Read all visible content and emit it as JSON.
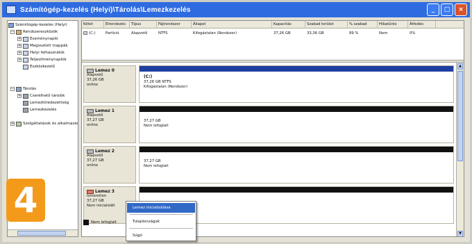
{
  "window": {
    "title": "Számítógép-kezelés (Helyi)\\Tárolás\\Lemezkezelés"
  },
  "tree": {
    "items": [
      {
        "label": "Számítógép-kezelés (Helyi)",
        "icon": "computer-icon"
      },
      {
        "label": "Rendszereszközök",
        "icon": "tools-icon"
      },
      {
        "label": "Eseménynapló",
        "icon": "event-viewer-icon"
      },
      {
        "label": "Megosztott mappák",
        "icon": "shared-folders-icon"
      },
      {
        "label": "Helyi felhasználók",
        "icon": "users-icon"
      },
      {
        "label": "Teljesítménynaplók",
        "icon": "performance-icon"
      },
      {
        "label": "Eszközkezelő",
        "icon": "device-manager-icon"
      },
      {
        "label": "Tárolás",
        "icon": "storage-icon"
      },
      {
        "label": "Cserélhető tárolók",
        "icon": "removable-storage-icon"
      },
      {
        "label": "Lemeztöredezettség",
        "icon": "defrag-icon"
      },
      {
        "label": "Lemezkezelés",
        "icon": "disk-management-icon"
      },
      {
        "label": "Szolgáltatások és alkalmazások",
        "icon": "services-icon"
      }
    ]
  },
  "volume_table": {
    "columns": [
      "Kötet",
      "Elrendezés",
      "Típus",
      "Fájlrendszer",
      "Állapot",
      "Kapacitás",
      "Szabad terület",
      "% szabad",
      "Hibatűrés",
      "Átfedés"
    ],
    "rows": [
      [
        "(C:)",
        "Partíció",
        "Alapvető",
        "NTFS",
        "Kifogástalan (Rendszer)",
        "37,26 GB",
        "33,36 GB",
        "89 %",
        "Nem",
        "0%"
      ]
    ]
  },
  "disks": [
    {
      "name": "Lemez 0",
      "type": "Alapvető",
      "size": "37,26 GB",
      "status": "online",
      "partition": {
        "label": "(C:)",
        "detail": "37,26 GB NTFS",
        "status": "Kifogástalan (Rendszer)"
      }
    },
    {
      "name": "Lemez 1",
      "type": "Alapvető",
      "size": "37,27 GB",
      "status": "online",
      "partition": {
        "label": "",
        "detail": "37,27 GB",
        "status": "Nem lefoglalt"
      }
    },
    {
      "name": "Lemez 2",
      "type": "Alapvető",
      "size": "37,27 GB",
      "status": "online",
      "partition": {
        "label": "",
        "detail": "37,27 GB",
        "status": "Nem lefoglalt"
      }
    },
    {
      "name": "Lemez 3",
      "type": "Ismeretlen",
      "size": "37,27 GB",
      "status": "Nem inicializált",
      "partition": {
        "label": "",
        "detail": "",
        "status": ""
      }
    }
  ],
  "legend": {
    "label": "Nem lefoglalt"
  },
  "context_menu": {
    "items": [
      "Lemez inicializálása",
      "Tulajdonságok",
      "Súgó"
    ]
  },
  "step_badge": "4",
  "colors": {
    "titlebar": "#2f6be0",
    "badge": "#f39a1b",
    "unallocated": "#111111",
    "primary": "#1f3fa0",
    "menu_highlight": "#3169c6"
  }
}
